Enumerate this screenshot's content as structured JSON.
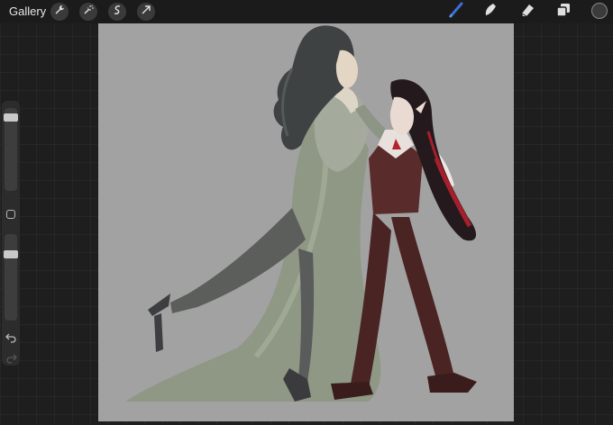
{
  "topbar": {
    "gallery_label": "Gallery",
    "left_tools": [
      "wrench-icon",
      "magic-wand-icon",
      "selection-icon",
      "transform-arrow-icon"
    ],
    "right_tools": [
      "brush-icon",
      "smudge-icon",
      "eraser-icon",
      "layers-icon",
      "color-swatch"
    ],
    "active_brush_color": "#3b6fd8",
    "current_color": "#3b3b3b"
  },
  "sidebar": {
    "brush_size_level": 0.08,
    "opacity_level": 0.2,
    "controls": [
      "brush-size-slider",
      "modify-button",
      "opacity-slider",
      "undo-icon",
      "redo-icon"
    ]
  },
  "canvas": {
    "background_color": "#a2a2a2",
    "subject": "artwork-two-figures-dancing"
  }
}
